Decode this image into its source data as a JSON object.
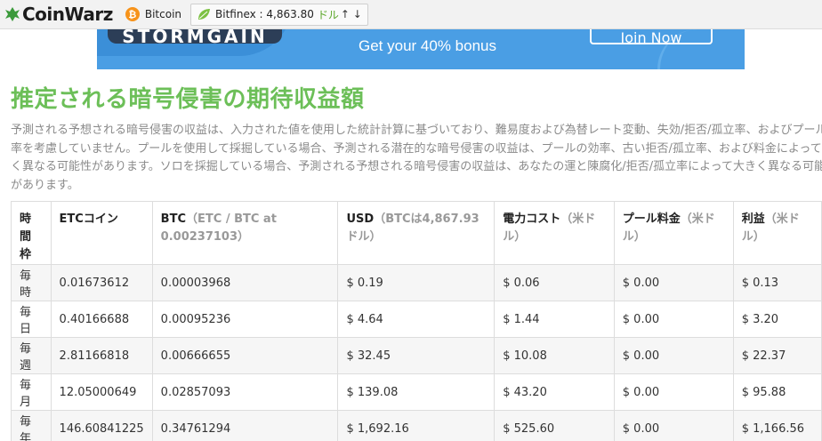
{
  "topbar": {
    "logo_text": "CoinWarz",
    "ticker_coin_symbol": "₿",
    "ticker_label": "Bitcoin",
    "exchange_label": "Bitfinex : 4,863.80",
    "exchange_unit": "ドル",
    "exchange_arrows": "↑ ↓",
    "colors": {
      "logo_green": "#3a9a3a",
      "ticker_orange": "#f7931a",
      "leaf_green": "#7cc142"
    }
  },
  "banner": {
    "brand": "STORMGAIN",
    "bonus_text": "Get your 40% bonus",
    "join_label": "Join Now",
    "color": "#4a9ee4"
  },
  "heading": "推定される暗号侵害の期待収益額",
  "description": "予測される予想される暗号侵害の収益は、入力された値を使用した統計計算に基づいており、難易度および為替レート変動、失効/拒否/孤立率、およびプール効率を考慮していません。プールを使用して採掘している場合、予測される潜在的な暗号侵害の収益は、プールの効率、古い拒否/孤立率、および料金によって大きく異なる可能性があります。ソロを採掘している場合、予測される予想される暗号侵害の収益は、あなたの運と陳腐化/拒否/孤立率によって大きく異なる可能性があります。",
  "table": {
    "headers": [
      {
        "main": "時間枠",
        "sub": ""
      },
      {
        "main": "ETCコイン",
        "sub": ""
      },
      {
        "main": "BTC",
        "sub": "（ETC / BTC at 0.00237103）"
      },
      {
        "main": "USD",
        "sub": "（BTCは4,867.93ドル）"
      },
      {
        "main": "電力コスト",
        "sub": "（米ドル）"
      },
      {
        "main": "プール料金",
        "sub": "（米ドル）"
      },
      {
        "main": "利益",
        "sub": "（米ドル）"
      }
    ],
    "rows": [
      [
        "毎時",
        "0.01673612",
        "0.00003968",
        "$ 0.19",
        "$ 0.06",
        "$ 0.00",
        "$ 0.13"
      ],
      [
        "毎日",
        "0.40166688",
        "0.00095236",
        "$ 4.64",
        "$ 1.44",
        "$ 0.00",
        "$ 3.20"
      ],
      [
        "毎週",
        "2.81166818",
        "0.00666655",
        "$ 32.45",
        "$ 10.08",
        "$ 0.00",
        "$ 22.37"
      ],
      [
        "毎月",
        "12.05000649",
        "0.02857093",
        "$ 139.08",
        "$ 43.20",
        "$ 0.00",
        "$ 95.88"
      ],
      [
        "毎年",
        "146.60841225",
        "0.34761294",
        "$ 1,692.16",
        "$ 525.60",
        "$ 0.00",
        "$ 1,166.56"
      ]
    ]
  }
}
